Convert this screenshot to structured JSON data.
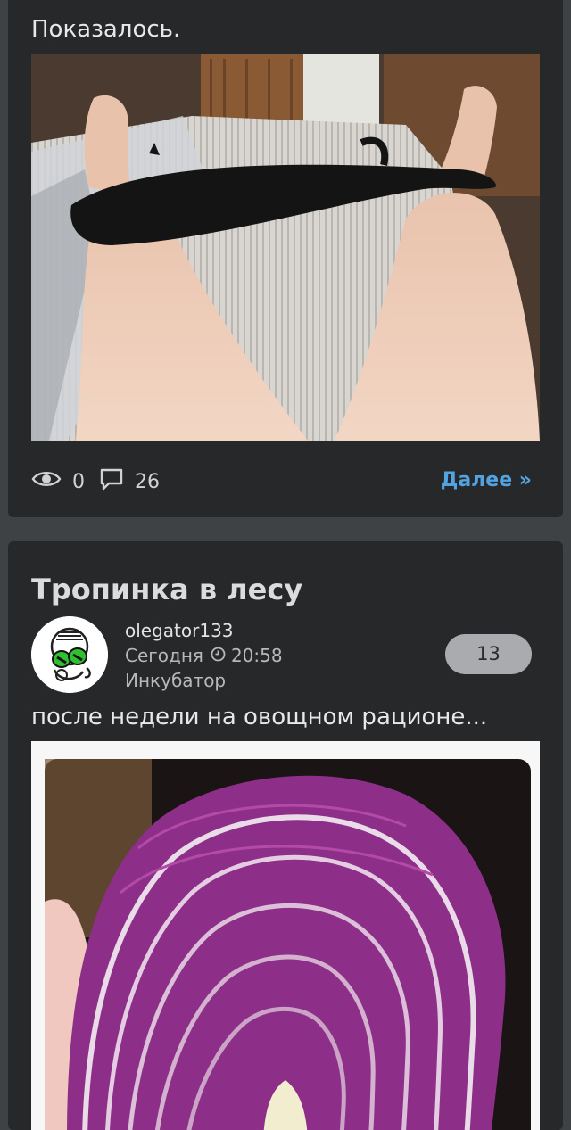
{
  "post1": {
    "caption": "Показалось.",
    "photo_alt": "кошка",
    "views": "0",
    "comments": "26",
    "more_label": "Далее »"
  },
  "post2": {
    "title": "Тропинка в лесу",
    "author": "olegator133",
    "date": "Сегодня",
    "time": "20:58",
    "category": "Инкубатор",
    "rating": "13",
    "caption": "после недели на овощном рационе...",
    "photo_alt": "краснокочанная капуста"
  },
  "icons": {
    "views": "eye-icon",
    "comments": "speech-bubble-icon",
    "time": "clock-icon"
  },
  "colors": {
    "background": "#3f4245",
    "card": "#27282a",
    "link": "#52a3e0",
    "badge": "#a9abae"
  }
}
